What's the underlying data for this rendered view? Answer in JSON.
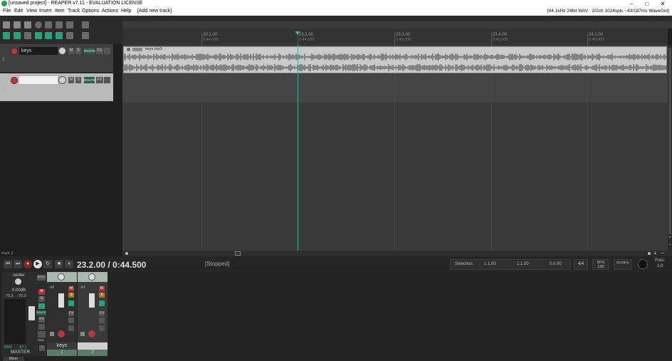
{
  "window": {
    "title": "[unsaved project] - REAPER v7.11 - EVALUATION LICENSE",
    "minimize": "–",
    "maximize": "□",
    "close": "✕"
  },
  "menu": {
    "items": [
      "File",
      "Edit",
      "View",
      "Insert",
      "Item",
      "Track",
      "Options",
      "Actions",
      "Help",
      "[Add new track]"
    ],
    "audio_status": "[44.1kHz 24bit WAV : 2/2ch 1024spls ~43/187ms WaveOut]"
  },
  "ruler": {
    "marks": [
      {
        "bar": "23.1.00",
        "time": "0:44.000"
      },
      {
        "bar": "23.2.00",
        "time": "0:44.500"
      },
      {
        "bar": "23.3.00",
        "time": "0:45.000"
      },
      {
        "bar": "23.4.00",
        "time": "0:45.500"
      },
      {
        "bar": "24.1.00",
        "time": "0:46.000"
      }
    ]
  },
  "tracks": [
    {
      "name": "keys",
      "number": "1",
      "route": "ROUTE",
      "fx": "FX",
      "mute": "M",
      "solo": "S"
    },
    {
      "name": "",
      "number": "2",
      "route": "ROUTE",
      "fx": "FX",
      "mute": "M",
      "solo": "S"
    }
  ],
  "item": {
    "name": "keys.mp3"
  },
  "footer_track_label": "track 2",
  "transport": {
    "time": "23.2.00 / 0:44.500",
    "status": "[Stopped]",
    "selection_label": "Selection:",
    "selection_start": "1.1.00",
    "selection_end": "1.1.00",
    "selection_length": "0.0.00",
    "time_sig": "4/4",
    "bpm_label": "BPM",
    "bpm": "120",
    "global_label": "GLOBAL",
    "rate_label": "Rate:",
    "rate": "1.0"
  },
  "mixer": {
    "master": {
      "pan": "center",
      "volume": "0.00dB",
      "peak_l": "-70.3",
      "peak_r": "-70.3",
      "rms_label": "RMS",
      "rms_value": "-87.1",
      "name": "MASTER",
      "mono": "MONO",
      "route": "ROUTE",
      "trim": "TRIM"
    },
    "strips": [
      {
        "name": "keys",
        "number": "1",
        "inf": "-inf"
      },
      {
        "name": "",
        "number": "2",
        "inf": "-inf"
      }
    ],
    "tab_label": "Mixer"
  }
}
